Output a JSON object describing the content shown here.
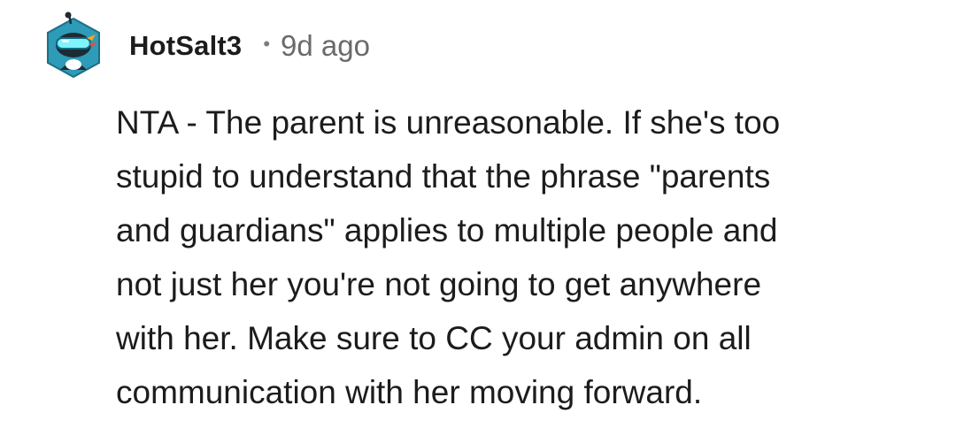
{
  "comment": {
    "author": {
      "username": "HotSalt3",
      "avatar_icon": "snoo-avatar-with-goggles-icon"
    },
    "separator": "•",
    "timestamp": "9d ago",
    "lines": [
      "NTA - The parent is unreasonable. If she's too",
      "stupid to understand that the phrase \"parents",
      "and guardians\" applies to multiple people and",
      "not just her you're not going to get anywhere",
      "with her. Make sure to CC your admin on all",
      "communication with her moving forward."
    ]
  },
  "colors": {
    "text": "#1c1c1c",
    "muted": "#6a6a6a",
    "avatar_bg": "#2e9bb8",
    "avatar_dark": "#1d2b33",
    "goggle_glow": "#7ff3ff"
  }
}
